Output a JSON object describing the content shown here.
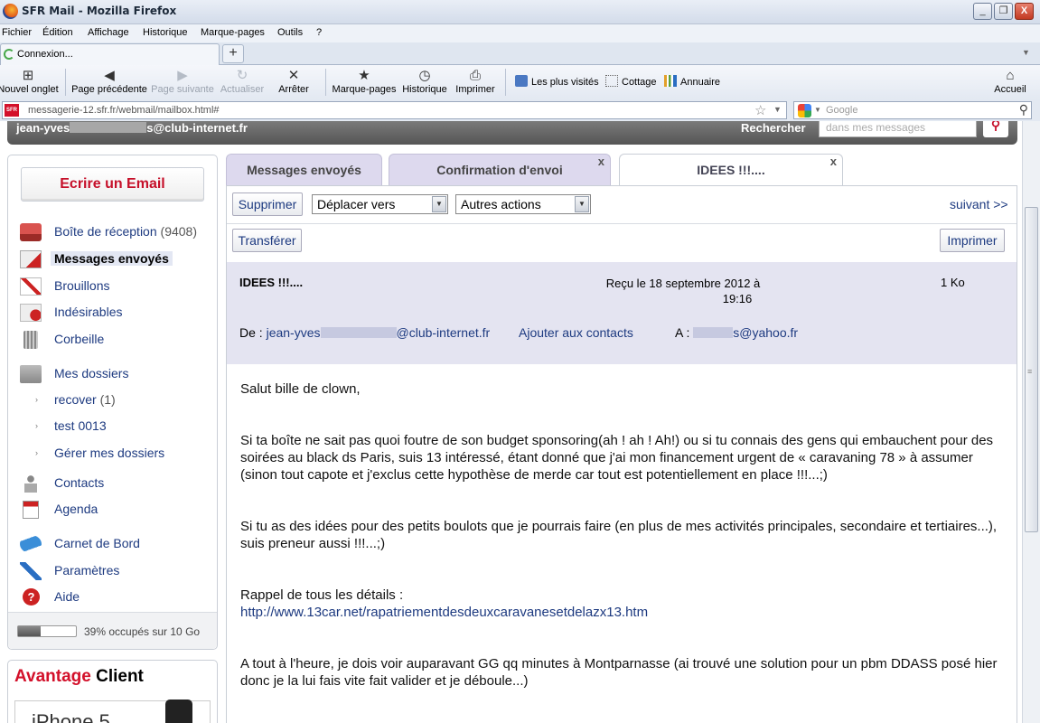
{
  "window": {
    "title": "SFR Mail - Mozilla Firefox",
    "min_label": "_",
    "max_label": "❐",
    "close_label": "X"
  },
  "menu": [
    "Fichier",
    "Édition",
    "Affichage",
    "Historique",
    "Marque-pages",
    "Outils",
    "?"
  ],
  "tab": {
    "label": "Connexion...",
    "new_tab": "+"
  },
  "toolbar": {
    "new_tab": "Nouvel onglet",
    "back": "Page précédente",
    "forward": "Page suivante",
    "reload": "Actualiser",
    "stop": "Arrêter",
    "bookmarks": "Marque-pages",
    "history": "Historique",
    "print": "Imprimer",
    "bm_visited": "Les plus visités",
    "bm_cottage": "Cottage",
    "bm_annuaire": "Annuaire",
    "home": "Accueil"
  },
  "urlbar": {
    "favicon": "SFR",
    "url": "messagerie-12.sfr.fr/webmail/mailbox.html#",
    "search_placeholder": "Google"
  },
  "webmail_header": {
    "user_prefix": "jean-yves",
    "user_suffix": "s@club-internet.fr",
    "search_label": "Rechercher",
    "search_placeholder": "dans mes messages"
  },
  "sidebar": {
    "write_button": "Ecrire un Email",
    "folders": [
      {
        "label": "Boîte de réception",
        "count": "(9408)"
      },
      {
        "label": "Messages envoyés",
        "count": ""
      },
      {
        "label": "Brouillons",
        "count": ""
      },
      {
        "label": "Indésirables",
        "count": ""
      },
      {
        "label": "Corbeille",
        "count": ""
      },
      {
        "label": "Mes dossiers",
        "count": ""
      },
      {
        "label": "recover",
        "count": "(1)"
      },
      {
        "label": "test 0013",
        "count": ""
      },
      {
        "label": "Gérer mes dossiers",
        "count": ""
      },
      {
        "label": "Contacts",
        "count": ""
      },
      {
        "label": "Agenda",
        "count": ""
      },
      {
        "label": "Carnet de Bord",
        "count": ""
      },
      {
        "label": "Paramètres",
        "count": ""
      },
      {
        "label": "Aide",
        "count": ""
      }
    ],
    "quota_text": "39% occupés sur 10 Go",
    "quota_fraction": 0.39
  },
  "ad": {
    "title_red": "Avantage",
    "title_black": "Client",
    "product": "iPhone 5"
  },
  "mail_tabs": [
    {
      "label": "Messages envoyés",
      "close": ""
    },
    {
      "label": "Confirmation d'envoi",
      "close": "x"
    },
    {
      "label": "IDEES !!!....",
      "close": "x"
    }
  ],
  "actions": {
    "delete": "Supprimer",
    "move": "Déplacer vers",
    "other": "Autres actions",
    "next": "suivant >>",
    "forward": "Transférer",
    "print": "Imprimer"
  },
  "message": {
    "subject": "IDEES !!!....",
    "received_line1": "Reçu le 18 septembre 2012 à",
    "received_line2": "19:16",
    "size": "1 Ko",
    "from_label": "De :",
    "from_prefix": "jean-yves",
    "from_suffix": "@club-internet.fr",
    "add_contact": "Ajouter aux contacts",
    "to_label": "A :",
    "to_suffix": "s@yahoo.fr",
    "body": [
      "Salut bille de clown,",
      "Si ta boîte ne sait pas quoi foutre de son budget sponsoring(ah ! ah ! Ah!) ou si tu connais des gens qui embauchent pour des soirées au black ds Paris, suis 13 intéressé, étant donné que j'ai mon financement urgent de « caravaning 78 » à assumer (sinon tout capote et j'exclus cette hypothèse de merde car tout est potentiellement en place !!!...;)",
      "Si tu as des idées pour des petits boulots que je pourrais faire (en plus de mes activités principales, secondaire et tertiaires...), suis preneur aussi !!!...;)",
      "Rappel de tous les détails :",
      "A tout à l'heure, je dois voir auparavant GG qq minutes à Montparnasse (ai trouvé une solution pour un pbm DDASS posé hier donc je la lui fais vite fait valider et je déboule...)"
    ],
    "link": "http://www.13car.net/rapatriementdesdeuxcaravanesetdelazx13.htm"
  }
}
